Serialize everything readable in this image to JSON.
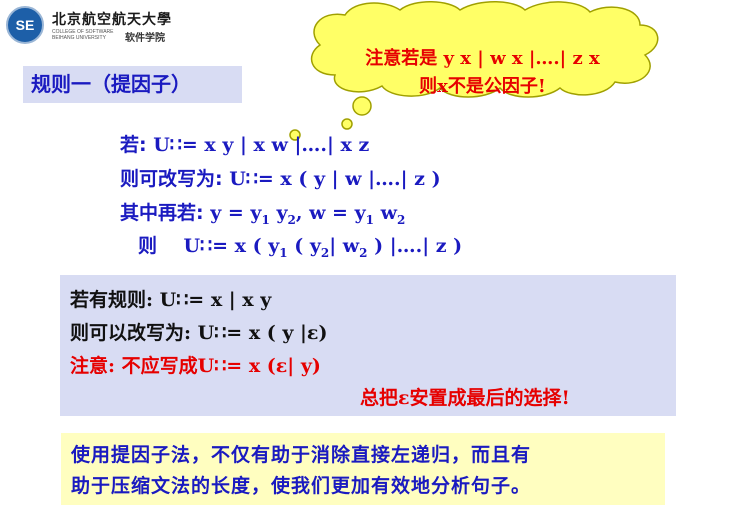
{
  "header": {
    "logo_badge": "SE",
    "university_name": "北京航空航天大學",
    "college_en": "COLLEGE OF SOFTWARE BEIHANG UNIVERSITY",
    "college_cn": "软件学院"
  },
  "title": "规则一（提因子）",
  "callout": {
    "line1": "注意若是 y x | w x |….| z x",
    "line2": "则x不是公因子!"
  },
  "example": {
    "l1_label": "若:",
    "l1_rule": "U∷= x y | x w |….| x z",
    "l2_label": "则可改写为:",
    "l2_rule": "U∷= x ( y | w |….| z )",
    "l3_label": "其中再若:",
    "l3_y": "y = y",
    "l3_y1": "1",
    "l3_ymid": " y",
    "l3_y2": "2",
    "l3_w": ",  w = y",
    "l3_w1": "1",
    "l3_wmid": " w",
    "l3_w2": "2",
    "l4_label": "则",
    "l4_pre": "U∷= x ( y",
    "l4_s1": "1",
    "l4_mid1": " ( y",
    "l4_s2": "2",
    "l4_mid2": "| w",
    "l4_s3": "2",
    "l4_post": " ) |….| z )"
  },
  "box2": {
    "l1": "若有规则: U∷= x | x y",
    "l2": "则可以改写为: U∷= x ( y |ε)",
    "l3": "注意: 不应写成U∷= x (ε| y)",
    "l4": "总把ε安置成最后的选择!"
  },
  "box3": {
    "l1": "使用提因子法，不仅有助于消除直接左递归，而且有",
    "l2": "助于压缩文法的长度，使我们更加有效地分析句子。"
  },
  "colors": {
    "blue_text": "#1a1ac0",
    "red_text": "#e60000",
    "panel_blue": "#d8dcf3",
    "panel_yellow": "#fffec0",
    "cloud_fill": "#ffff66"
  }
}
